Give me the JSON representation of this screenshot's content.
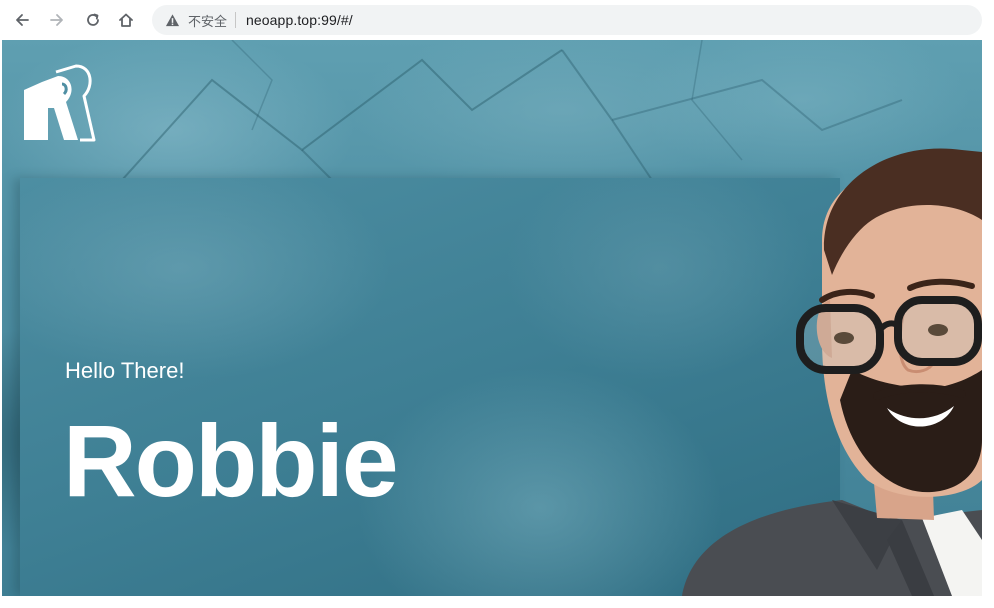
{
  "browser": {
    "security_label": "不安全",
    "url": "neoapp.top:99/#/",
    "icons": {
      "back": "arrow-left-icon",
      "forward": "arrow-right-icon",
      "reload": "reload-icon",
      "home": "home-icon",
      "security": "warning-triangle-icon"
    }
  },
  "hero": {
    "logo_icon": "rr-logo",
    "greeting": "Hello There!",
    "name": "Robbie",
    "portrait_icon": "smiling-man-with-glasses-portrait"
  },
  "colors": {
    "background_teal": "#4f8fa3",
    "panel_teal": "#3e7f94",
    "text": "#ffffff"
  }
}
